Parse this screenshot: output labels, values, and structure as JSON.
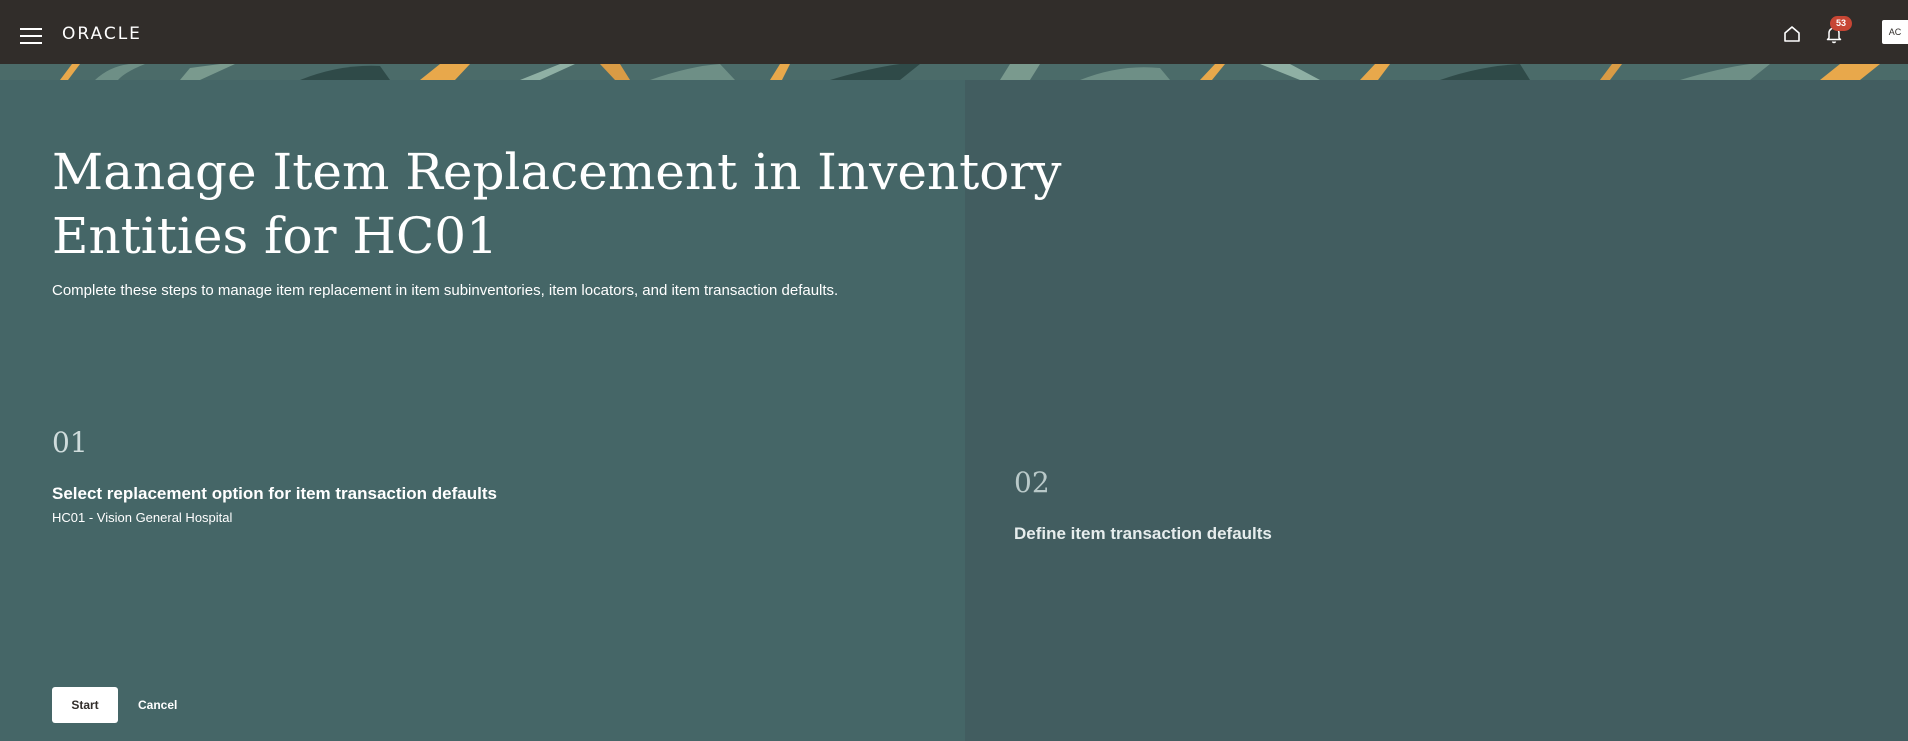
{
  "header": {
    "logo_text": "ORACLE",
    "notification_count": "53",
    "avatar_initials": "AC"
  },
  "page": {
    "title": "Manage Item Replacement in Inventory Entities for HC01",
    "description": "Complete these steps to manage item replacement in item subinventories, item locators, and item transaction defaults."
  },
  "steps": [
    {
      "number": "01",
      "title": "Select replacement option for item transaction defaults",
      "subtitle": "HC01 - Vision General Hospital"
    },
    {
      "number": "02",
      "title": "Define item transaction defaults"
    }
  ],
  "actions": {
    "start_label": "Start",
    "cancel_label": "Cancel"
  },
  "colors": {
    "topbar": "#312d2a",
    "panel_left": "#456667",
    "panel_right": "#425d60",
    "badge": "#c74634"
  },
  "icons": {
    "menu": "hamburger-menu-icon",
    "home": "home-icon",
    "notifications": "bell-icon"
  }
}
